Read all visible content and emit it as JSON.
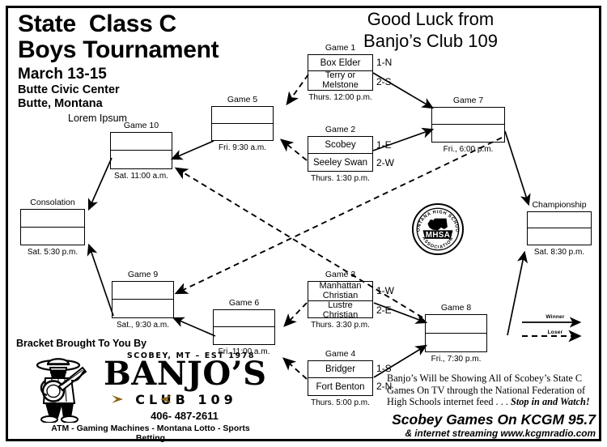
{
  "header": {
    "title_line1": "State  Class C",
    "title_line2": "Boys Tournament",
    "dates": "March 13-15",
    "venue": "Butte Civic Center",
    "city": "Butte, Montana",
    "lorem": "Lorem Ipsum",
    "good_luck_line1": "Good Luck from",
    "good_luck_line2": "Banjo’s Club 109"
  },
  "games": {
    "game1": {
      "label": "Game 1",
      "top_team": "Box Elder",
      "bottom_team": "Terry or Melstone",
      "top_seed": "1-N",
      "bottom_seed": "2-S",
      "time": "Thurs. 12:00 p.m."
    },
    "game2": {
      "label": "Game 2",
      "top_team": "Scobey",
      "bottom_team": "Seeley Swan",
      "top_seed": "1-E",
      "bottom_seed": "2-W",
      "time": "Thurs. 1:30 p.m."
    },
    "game3": {
      "label": "Game 3",
      "top_team": "Manhattan Christian",
      "bottom_team": "Lustre Christian",
      "top_seed": "1-W",
      "bottom_seed": "2-E",
      "time": "Thurs. 3:30 p.m."
    },
    "game4": {
      "label": "Game 4",
      "top_team": "Bridger",
      "bottom_team": "Fort Benton",
      "top_seed": "1-S",
      "bottom_seed": "2-N",
      "time": "Thurs. 5:00 p.m."
    },
    "game5": {
      "label": "Game 5",
      "top_team": "",
      "bottom_team": "",
      "time": "Fri. 9:30 a.m."
    },
    "game6": {
      "label": "Game 6",
      "top_team": "",
      "bottom_team": "",
      "time": "Fri. 11:00 a.m."
    },
    "game7": {
      "label": "Game 7",
      "top_team": "",
      "bottom_team": "",
      "time": "Fri., 6:00 p.m."
    },
    "game8": {
      "label": "Game 8",
      "top_team": "",
      "bottom_team": "",
      "time": "Fri., 7:30 p.m."
    },
    "game9": {
      "label": "Game 9",
      "top_team": "",
      "bottom_team": "",
      "time": "Sat., 9:30 a.m."
    },
    "game10": {
      "label": "Game 10",
      "top_team": "",
      "bottom_team": "",
      "time": "Sat. 11:00 a.m."
    },
    "consolation": {
      "label": "Consolation",
      "top_team": "",
      "bottom_team": "",
      "time": "Sat. 5:30 p.m."
    },
    "championship": {
      "label": "Championship",
      "top_team": "",
      "bottom_team": "",
      "time": "Sat. 8:30 p.m."
    }
  },
  "legend": {
    "winner": "Winner",
    "loser": "Loser"
  },
  "logo_mhsa": {
    "arc_top": "MONTANA HIGH SCHOOL",
    "center": "MHSA",
    "arc_bottom": "ASSOCIATION"
  },
  "sponsor": {
    "bracket_by": "Bracket Brought To You By",
    "scobey_est": "SCOBEY, MT – EST 1978",
    "name": "BANJO’S",
    "club": "CLUB 109",
    "phone": "406- 487-2611",
    "tagline": "ATM - Gaming Machines - Montana Lotto -  Sports Betting"
  },
  "promo": {
    "line1": "Banjo’s Will be Showing All of Scobey’s State C",
    "line2": "Games On TV through the National Federation of",
    "line3": "High Schools internet feed . . .",
    "stop": "Stop in and Watch!",
    "kcgm": "Scobey Games On KCGM 95.7",
    "stream": "& internet streaming  www.kcgmradio.com"
  },
  "colors": {
    "ink": "#000000",
    "paper": "#ffffff",
    "gold": "#8a6518"
  }
}
